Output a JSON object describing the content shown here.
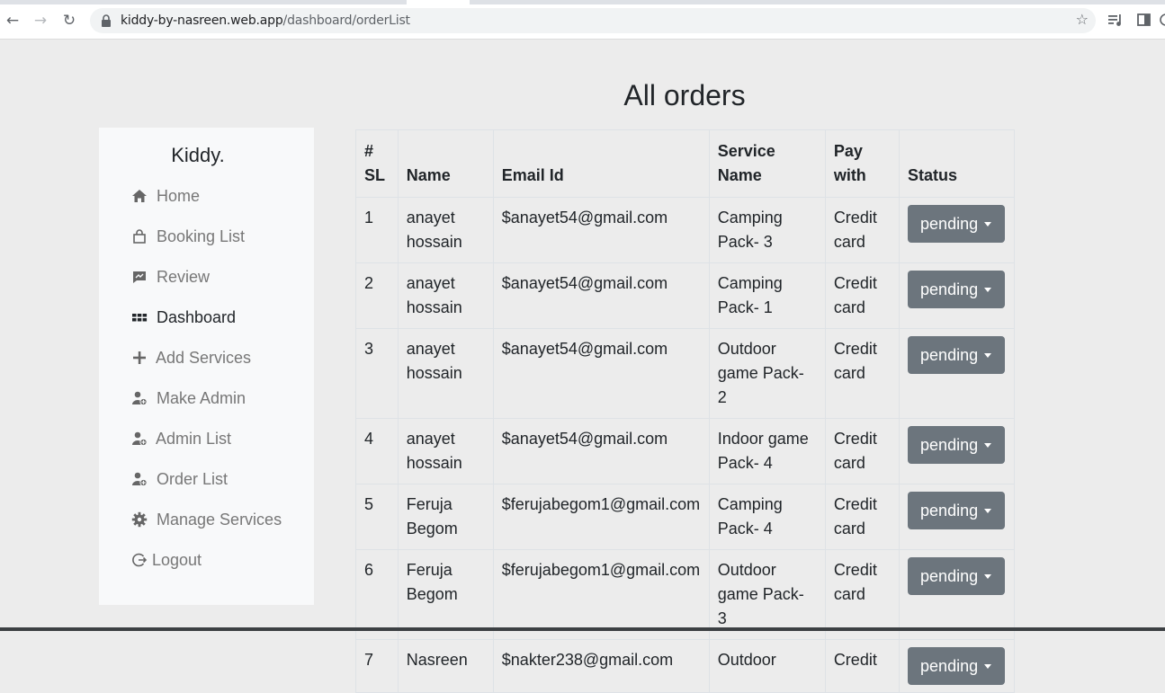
{
  "browser": {
    "url_host": "kiddy-by-nasreen.web.app",
    "url_path": "/dashboard/orderList"
  },
  "page": {
    "title": "All orders"
  },
  "sidebar": {
    "brand": "Kiddy.",
    "items": [
      {
        "label": "Home",
        "icon": "home-icon",
        "active": false
      },
      {
        "label": "Booking List",
        "icon": "shopping-bag-icon",
        "active": false
      },
      {
        "label": "Review",
        "icon": "review-icon",
        "active": false
      },
      {
        "label": "Dashboard",
        "icon": "dashboard-grid-icon",
        "active": true
      },
      {
        "label": "Add Services",
        "icon": "plus-icon",
        "active": false
      },
      {
        "label": "Make Admin",
        "icon": "user-plus-icon",
        "active": false
      },
      {
        "label": "Admin List",
        "icon": "user-plus-icon",
        "active": false
      },
      {
        "label": "Order List",
        "icon": "user-plus-icon",
        "active": false
      },
      {
        "label": "Manage Services",
        "icon": "gear-icon",
        "active": false
      },
      {
        "label": "Logout",
        "icon": "logout-icon",
        "active": false
      }
    ]
  },
  "table": {
    "headers": {
      "sl_line1": "#",
      "sl_line2": "SL",
      "name": "Name",
      "email": "Email Id",
      "service_line1": "Service",
      "service_line2": "Name",
      "pay_line1": "Pay",
      "pay_line2": "with",
      "status": "Status"
    },
    "rows": [
      {
        "sl": "1",
        "name1": "anayet",
        "name2": "hossain",
        "email": "$anayet54@gmail.com",
        "svc1": "Camping",
        "svc2": "Pack- 3",
        "pay1": "Credit",
        "pay2": "card",
        "status": "pending"
      },
      {
        "sl": "2",
        "name1": "anayet",
        "name2": "hossain",
        "email": "$anayet54@gmail.com",
        "svc1": "Camping",
        "svc2": "Pack- 1",
        "pay1": "Credit",
        "pay2": "card",
        "status": "pending"
      },
      {
        "sl": "3",
        "name1": "anayet",
        "name2": "hossain",
        "email": "$anayet54@gmail.com",
        "svc1": "Outdoor",
        "svc2": "game Pack- 2",
        "pay1": "Credit",
        "pay2": "card",
        "status": "pending"
      },
      {
        "sl": "4",
        "name1": "anayet",
        "name2": "hossain",
        "email": "$anayet54@gmail.com",
        "svc1": "Indoor game",
        "svc2": "Pack- 4",
        "pay1": "Credit",
        "pay2": "card",
        "status": "pending"
      },
      {
        "sl": "5",
        "name1": "Feruja",
        "name2": "Begom",
        "email": "$ferujabegom1@gmail.com",
        "svc1": "Camping",
        "svc2": "Pack- 4",
        "pay1": "Credit",
        "pay2": "card",
        "status": "pending"
      },
      {
        "sl": "6",
        "name1": "Feruja",
        "name2": "Begom",
        "email": "$ferujabegom1@gmail.com",
        "svc1": "Outdoor",
        "svc2": "game Pack- 3",
        "pay1": "Credit",
        "pay2": "card",
        "status": "pending"
      },
      {
        "sl": "7",
        "name1": "Nasreen",
        "name2": "",
        "email": "$nakter238@gmail.com",
        "svc1": "Outdoor",
        "svc2": "",
        "pay1": "Credit",
        "pay2": "",
        "status": "pending"
      }
    ]
  },
  "colors": {
    "page_bg": "#ececec",
    "sidebar_bg": "#f8f9fa",
    "status_button": "#6c757d"
  }
}
